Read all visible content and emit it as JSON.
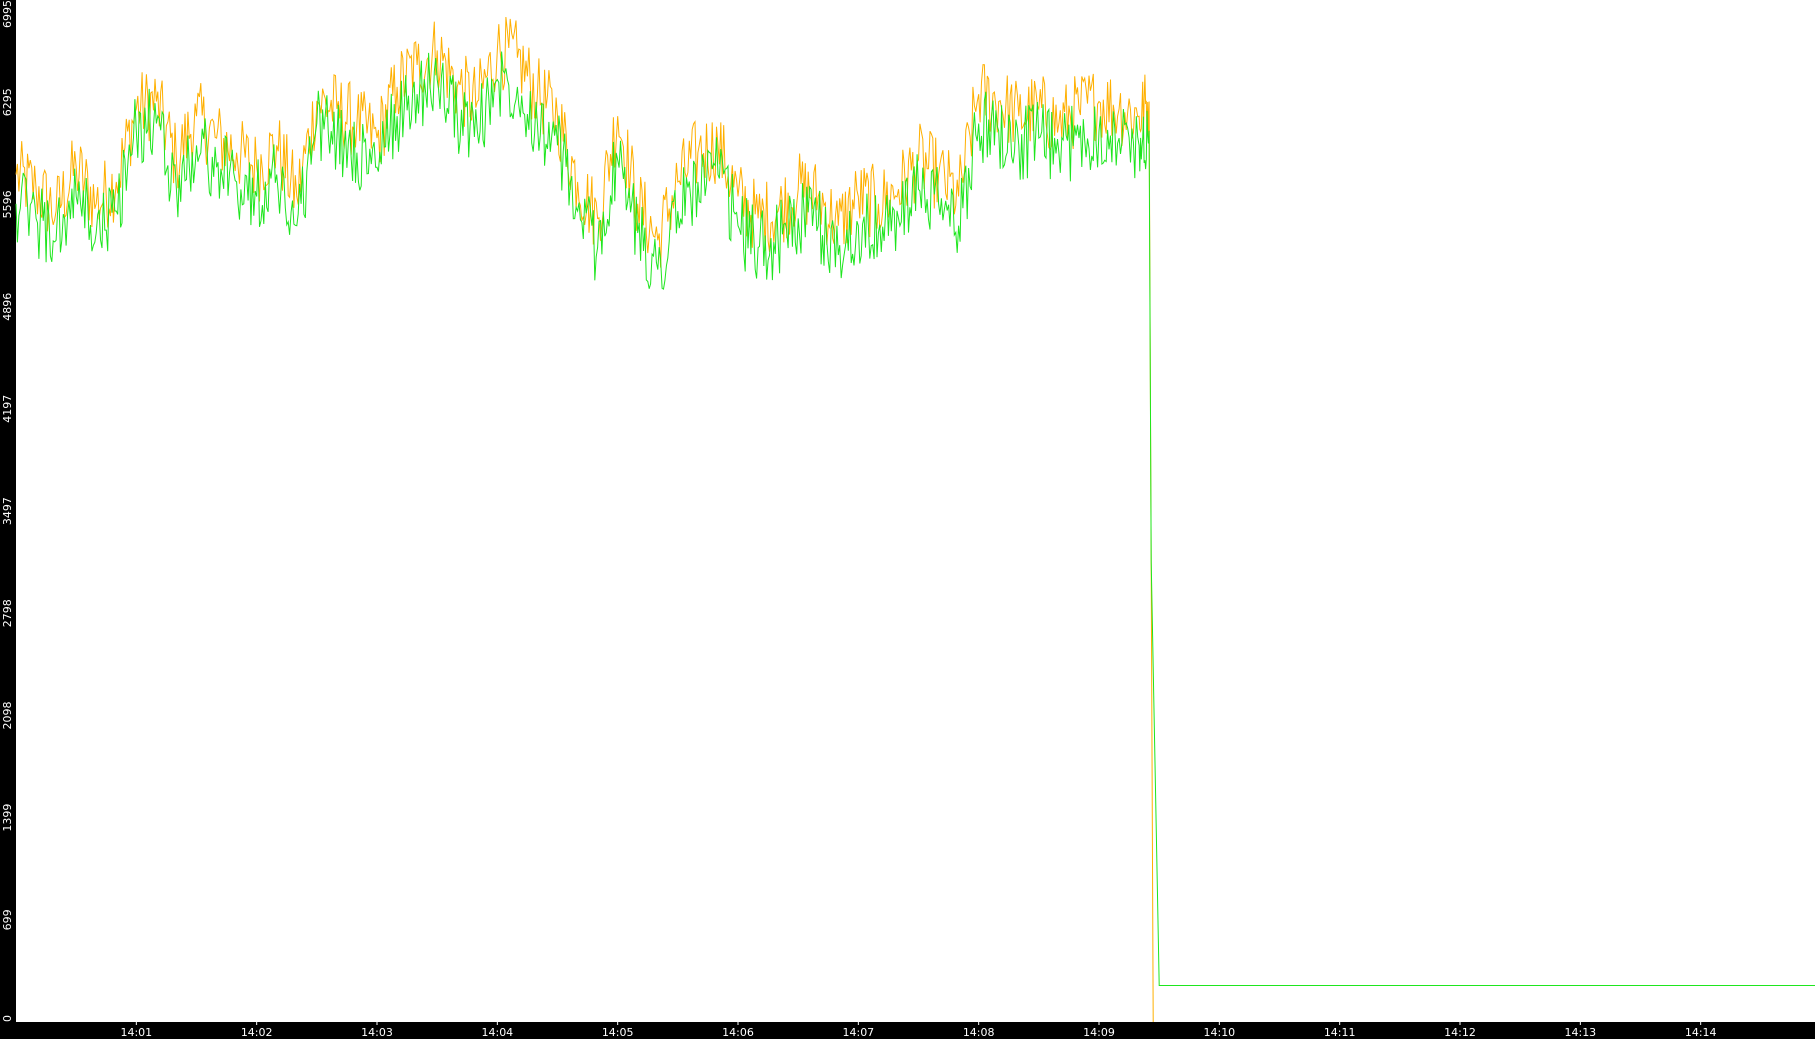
{
  "colors": {
    "background": "#000000",
    "plot_background": "#ffffff",
    "axis_text": "#ffffff",
    "series_orange": "#ffb000",
    "series_green": "#1ee61e"
  },
  "chart_data": {
    "type": "line",
    "title": "",
    "xlabel": "",
    "ylabel": "",
    "ylim": [
      0,
      6995
    ],
    "xlim": [
      "14:00:00",
      "14:14:57"
    ],
    "grid": false,
    "legend": "none",
    "y_ticks": [
      0,
      699,
      1399,
      2098,
      2798,
      3497,
      4197,
      4896,
      5596,
      6295,
      6995
    ],
    "x_ticks": [
      "14:01",
      "14:02",
      "14:03",
      "14:04",
      "14:05",
      "14:06",
      "14:07",
      "14:08",
      "14:09",
      "14:10",
      "14:11",
      "14:12",
      "14:13",
      "14:14"
    ],
    "series": [
      {
        "color": "#ffb000",
        "x": [
          "14:00:00",
          "14:00:10",
          "14:00:20",
          "14:00:30",
          "14:00:40",
          "14:00:50",
          "14:01:00",
          "14:01:10",
          "14:01:20",
          "14:01:30",
          "14:01:40",
          "14:01:50",
          "14:02:00",
          "14:02:10",
          "14:02:20",
          "14:02:30",
          "14:02:40",
          "14:02:50",
          "14:03:00",
          "14:03:10",
          "14:03:20",
          "14:03:30",
          "14:03:40",
          "14:03:50",
          "14:04:00",
          "14:04:10",
          "14:04:20",
          "14:04:30",
          "14:04:40",
          "14:04:50",
          "14:05:00",
          "14:05:10",
          "14:05:20",
          "14:05:30",
          "14:05:40",
          "14:05:50",
          "14:06:00",
          "14:06:10",
          "14:06:20",
          "14:06:30",
          "14:06:40",
          "14:06:50",
          "14:07:00",
          "14:07:10",
          "14:07:20",
          "14:07:30",
          "14:07:40",
          "14:07:50",
          "14:08:00",
          "14:08:10",
          "14:08:20",
          "14:08:30",
          "14:08:40",
          "14:08:50",
          "14:09:00",
          "14:09:10",
          "14:09:20",
          "14:09:25",
          "14:09:26",
          "14:09:27"
        ],
        "values": [
          5800,
          5700,
          5550,
          5850,
          5600,
          5750,
          6250,
          6300,
          5900,
          6200,
          6050,
          5950,
          5850,
          6000,
          5650,
          6300,
          6250,
          6150,
          6050,
          6400,
          6550,
          6650,
          6400,
          6300,
          6650,
          6600,
          6350,
          6200,
          5750,
          5500,
          6200,
          5600,
          5350,
          5750,
          5950,
          6000,
          5650,
          5500,
          5550,
          5700,
          5650,
          5450,
          5650,
          5600,
          5700,
          5900,
          5800,
          5650,
          6350,
          6300,
          6200,
          6250,
          6150,
          6250,
          6300,
          6250,
          6200,
          6300,
          3100,
          0
        ]
      },
      {
        "color": "#1ee61e",
        "x": [
          "14:00:00",
          "14:00:10",
          "14:00:20",
          "14:00:30",
          "14:00:40",
          "14:00:50",
          "14:01:00",
          "14:01:10",
          "14:01:20",
          "14:01:30",
          "14:01:40",
          "14:01:50",
          "14:02:00",
          "14:02:10",
          "14:02:20",
          "14:02:30",
          "14:02:40",
          "14:02:50",
          "14:03:00",
          "14:03:10",
          "14:03:20",
          "14:03:30",
          "14:03:40",
          "14:03:50",
          "14:04:00",
          "14:04:10",
          "14:04:20",
          "14:04:30",
          "14:04:40",
          "14:04:50",
          "14:05:00",
          "14:05:10",
          "14:05:20",
          "14:05:30",
          "14:05:40",
          "14:05:50",
          "14:06:00",
          "14:06:10",
          "14:06:20",
          "14:06:30",
          "14:06:40",
          "14:06:50",
          "14:07:00",
          "14:07:10",
          "14:07:20",
          "14:07:30",
          "14:07:40",
          "14:07:50",
          "14:08:00",
          "14:08:10",
          "14:08:20",
          "14:08:30",
          "14:08:40",
          "14:08:50",
          "14:09:00",
          "14:09:10",
          "14:09:20",
          "14:09:25",
          "14:09:26",
          "14:09:30",
          "14:14:57"
        ],
        "values": [
          5600,
          5500,
          5350,
          5650,
          5400,
          5550,
          6100,
          6150,
          5700,
          6000,
          5850,
          5750,
          5650,
          5800,
          5450,
          6150,
          6050,
          5950,
          5850,
          6200,
          6350,
          6450,
          6200,
          6100,
          6450,
          6400,
          6150,
          6000,
          5550,
          5300,
          5900,
          5400,
          5150,
          5550,
          5750,
          5800,
          5450,
          5300,
          5350,
          5500,
          5450,
          5250,
          5450,
          5400,
          5500,
          5700,
          5600,
          5450,
          6150,
          6100,
          6000,
          6050,
          5950,
          6050,
          6100,
          6050,
          6000,
          6100,
          3150,
          250,
          250
        ]
      }
    ]
  }
}
